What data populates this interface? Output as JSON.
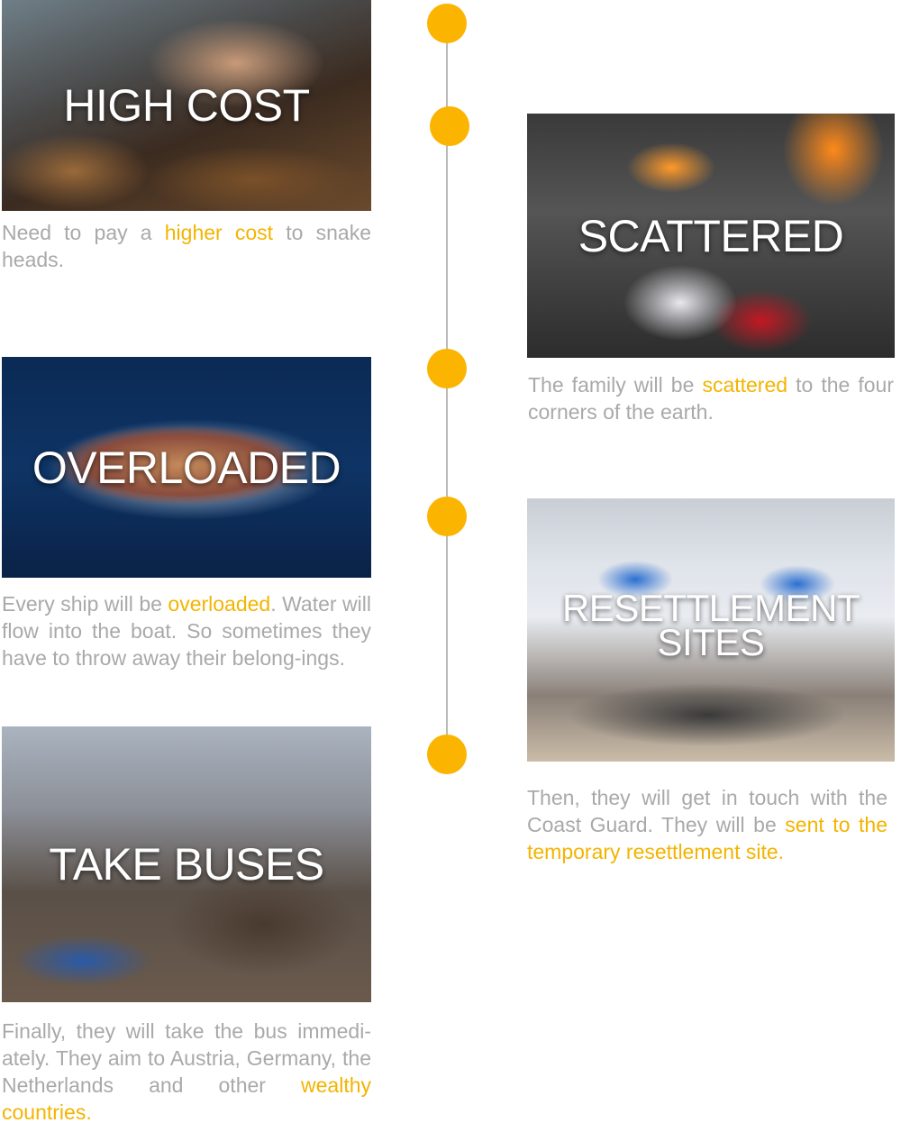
{
  "accent_color": "#fbb400",
  "text_color": "#a9a9a9",
  "cards": {
    "high_cost": {
      "label": "HIGH COST",
      "desc_before": "Need to pay a ",
      "highlight": "higher cost",
      "desc_after": " to snake heads."
    },
    "scattered": {
      "label": "SCATTERED",
      "desc_before": "The family will be ",
      "highlight": "scattered",
      "desc_after": " to the four corners of the earth."
    },
    "overloaded": {
      "label": "OVERLOADED",
      "desc_before": "Every ship will be ",
      "highlight": "overloaded",
      "desc_after": ". Water will flow into the boat. So sometimes they have to throw away their belong-ings."
    },
    "resettlement": {
      "label_line1": "RESETTLEMENT",
      "label_line2": "SITES",
      "desc_before": "Then, they will get in touch with the Coast Guard. They will be ",
      "highlight": "sent to the temporary resettlement site."
    },
    "take_buses": {
      "label": "TAKE BUSES",
      "desc_before": "Finally, they will take the bus immedi-ately. They aim to Austria, Germany, the Netherlands and other ",
      "highlight": "wealthy countries."
    }
  }
}
